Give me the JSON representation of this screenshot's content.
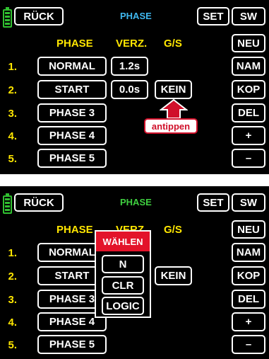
{
  "screen1": {
    "back_label": "RÜCK",
    "title": "PHASE",
    "set_label": "SET",
    "col_headers": [
      "PHASE",
      "VERZ.",
      "G/S"
    ],
    "rows": [
      {
        "num": "1.",
        "name": "NORMAL",
        "delay": "1.2s",
        "gs": ""
      },
      {
        "num": "2.",
        "name": "START",
        "delay": "0.0s",
        "gs": "KEIN"
      },
      {
        "num": "3.",
        "name": "PHASE 3",
        "delay": "",
        "gs": ""
      },
      {
        "num": "4.",
        "name": "PHASE 4",
        "delay": "",
        "gs": ""
      },
      {
        "num": "5.",
        "name": "PHASE 5",
        "delay": "",
        "gs": ""
      }
    ],
    "side_buttons": [
      "SW",
      "NEU",
      "NAM",
      "KOP",
      "DEL",
      "+",
      "–"
    ],
    "callout": "antippen"
  },
  "screen2": {
    "back_label": "RÜCK",
    "title": "PHASE",
    "set_label": "SET",
    "col_headers": [
      "PHASE",
      "VERZ.",
      "G/S"
    ],
    "rows": [
      {
        "num": "1.",
        "name": "NORMAL"
      },
      {
        "num": "2.",
        "name": "START",
        "gs": "KEIN"
      },
      {
        "num": "3.",
        "name": "PHASE 3"
      },
      {
        "num": "4.",
        "name": "PHASE 4"
      },
      {
        "num": "5.",
        "name": "PHASE 5"
      }
    ],
    "side_buttons": [
      "SW",
      "NEU",
      "NAM",
      "KOP",
      "DEL",
      "+",
      "–"
    ],
    "popup": {
      "title": "WÄHLEN",
      "options": [
        "N",
        "CLR",
        "LOGIC"
      ]
    }
  },
  "colors": {
    "accent_yellow": "#ffe600",
    "title_blue": "#3fb8f0",
    "title_green": "#3fd040",
    "popup_red": "#e3132a",
    "callout_red": "#d0102a"
  }
}
